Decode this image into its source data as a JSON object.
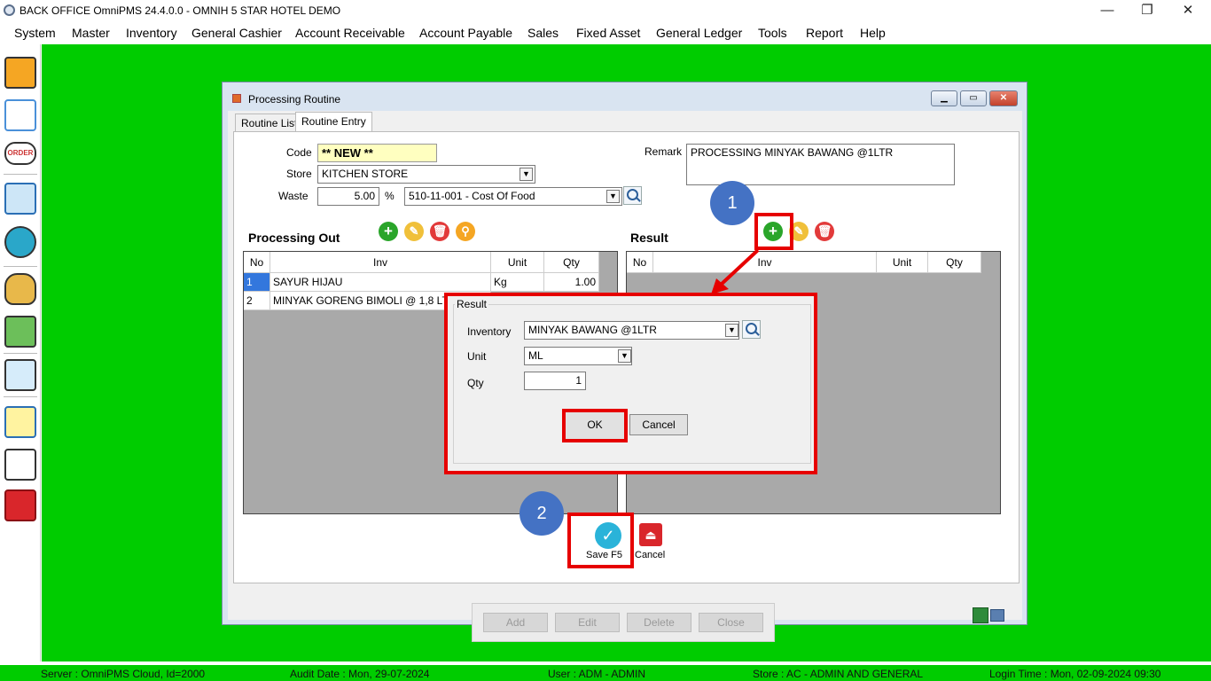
{
  "window": {
    "title": "BACK OFFICE OmniPMS 24.4.0.0 - OMNIH 5 STAR HOTEL DEMO",
    "minimize": "—",
    "restore": "❐",
    "close": "✕"
  },
  "menu": [
    "System",
    "Master",
    "Inventory",
    "General Cashier",
    "Account Receivable",
    "Account Payable",
    "Sales",
    "Fixed Asset",
    "General Ledger",
    "Tools",
    "Report",
    "Help"
  ],
  "sidebar": {
    "icons": [
      "inventory-boxes-icon",
      "checklist-icon",
      "order-icon",
      "shopping-cart-icon",
      "cashier-icon",
      "money-bag-icon",
      "payment-hand-icon",
      "mobile-touch-icon",
      "report-book-icon",
      "chart-icon",
      "exit-icon"
    ],
    "order_text": "ORDER"
  },
  "child": {
    "title": "Processing Routine",
    "tabs": [
      "Routine List",
      "Routine Entry"
    ],
    "active_tab": "Routine Entry",
    "form": {
      "code_label": "Code",
      "code_value": "** NEW **",
      "store_label": "Store",
      "store_value": "KITCHEN STORE",
      "waste_label": "Waste",
      "waste_value": "5.00",
      "waste_unit": "%",
      "account_value": "510-11-001 - Cost Of Food",
      "remark_label": "Remark",
      "remark_value": "PROCESSING MINYAK BAWANG @1LTR"
    },
    "processing_out": {
      "title": "Processing Out",
      "columns": [
        "No",
        "Inv",
        "Unit",
        "Qty"
      ],
      "rows": [
        {
          "no": "1",
          "inv": "SAYUR HIJAU",
          "unit": "Kg",
          "qty": "1.00"
        },
        {
          "no": "2",
          "inv": "MINYAK GORENG BIMOLI @ 1,8 LTR",
          "unit": "",
          "qty": ""
        }
      ]
    },
    "result": {
      "title": "Result",
      "columns": [
        "No",
        "Inv",
        "Unit",
        "Qty"
      ]
    },
    "actions": {
      "save": "Save F5",
      "cancel": "Cancel"
    },
    "bottom_buttons": [
      "Add",
      "Edit",
      "Delete",
      "Close"
    ]
  },
  "dialog": {
    "group_title": "Result",
    "inventory_label": "Inventory",
    "inventory_value": "MINYAK BAWANG @1LTR",
    "unit_label": "Unit",
    "unit_value": "ML",
    "qty_label": "Qty",
    "qty_value": "1",
    "ok": "OK",
    "cancel": "Cancel"
  },
  "annotations": {
    "step1": "1",
    "step2": "2"
  },
  "status": {
    "server": "Server : OmniPMS Cloud, Id=2000",
    "audit_date": "Audit Date : Mon, 29-07-2024",
    "user": "User : ADM - ADMIN",
    "store": "Store : AC - ADMIN AND GENERAL",
    "login_time": "Login Time : Mon, 02-09-2024 09:30"
  },
  "colors": {
    "desktop": "#00cc00",
    "highlight": "#e60000",
    "bubble": "#4472c4",
    "selected_row": "#3377dd",
    "code_field": "#ffffc0"
  }
}
